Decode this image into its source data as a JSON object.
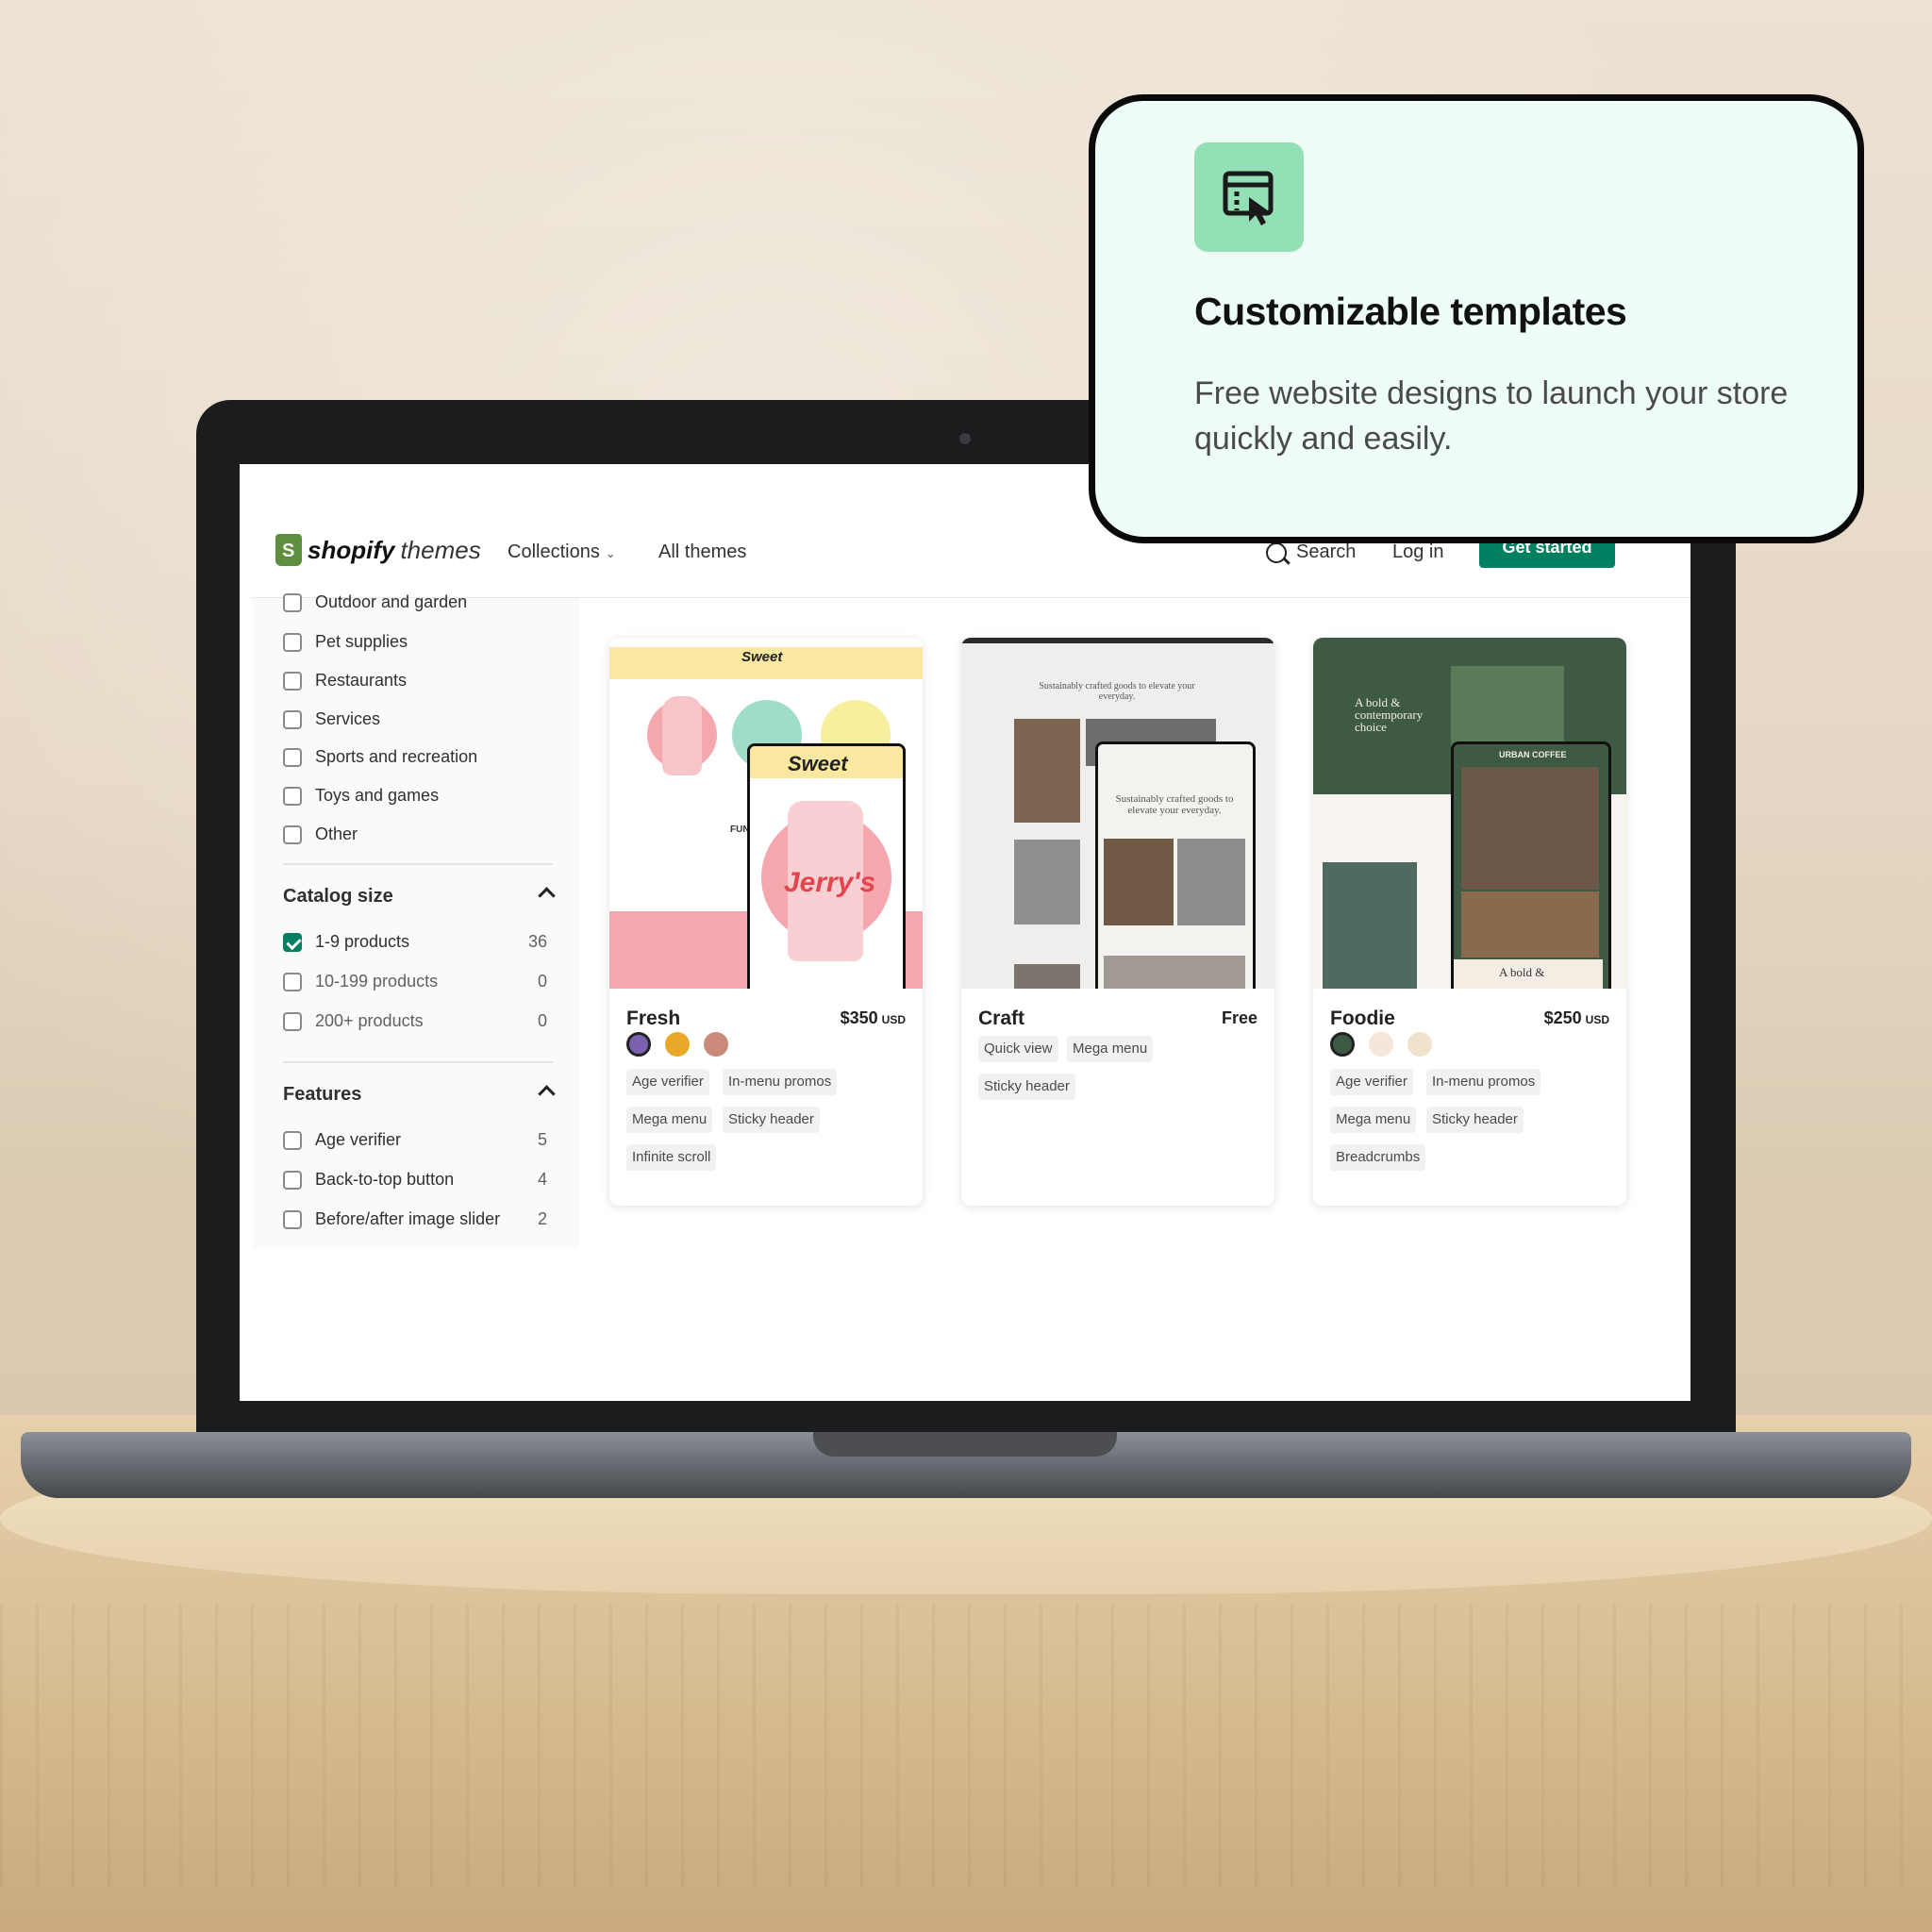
{
  "overlay": {
    "title": "Customizable templates",
    "subtitle": "Free website designs to launch your store quickly and easily.",
    "icon": "template-cursor-icon",
    "accent": "#93e0b6"
  },
  "nav": {
    "brand": "shopify",
    "brand_suffix": "themes",
    "collections": "Collections",
    "all_themes": "All themes",
    "search": "Search",
    "login": "Log in",
    "get_started": "Get started",
    "accent": "#008060"
  },
  "sidebar": {
    "industry_items": [
      {
        "label": "Outdoor and garden",
        "checked": false
      },
      {
        "label": "Pet supplies",
        "checked": false
      },
      {
        "label": "Restaurants",
        "checked": false
      },
      {
        "label": "Services",
        "checked": false
      },
      {
        "label": "Sports and recreation",
        "checked": false
      },
      {
        "label": "Toys and games",
        "checked": false
      },
      {
        "label": "Other",
        "checked": false
      }
    ],
    "catalog_size": {
      "title": "Catalog size",
      "items": [
        {
          "label": "1-9 products",
          "count": "36",
          "checked": true
        },
        {
          "label": "10-199 products",
          "count": "0",
          "checked": false
        },
        {
          "label": "200+ products",
          "count": "0",
          "checked": false
        }
      ]
    },
    "features": {
      "title": "Features",
      "items": [
        {
          "label": "Age verifier",
          "count": "5",
          "checked": false
        },
        {
          "label": "Back-to-top button",
          "count": "4",
          "checked": false
        },
        {
          "label": "Before/after image slider",
          "count": "2",
          "checked": false
        }
      ]
    }
  },
  "themes": [
    {
      "name": "Fresh",
      "price": "$350",
      "currency": "USD",
      "swatches": [
        "#7b62b0",
        "#eaa82a",
        "#c98a7a"
      ],
      "tags": [
        "Age verifier",
        "In-menu promos",
        "Mega menu",
        "Sticky header",
        "Infinite scroll"
      ],
      "preview": {
        "desktop_logo": "Sweet",
        "mobile_logo": "Sweet",
        "can_text": "Jerry's",
        "fun_text": "FUN."
      }
    },
    {
      "name": "Craft",
      "price": "Free",
      "currency": "",
      "swatches": [],
      "tags": [
        "Quick view",
        "Mega menu",
        "Sticky header"
      ],
      "preview": {
        "headline": "Sustainably crafted goods to elevate your everyday.",
        "mobile_headline": "Sustainably crafted goods to elevate your everyday."
      }
    },
    {
      "name": "Foodie",
      "price": "$250",
      "currency": "USD",
      "swatches": [
        "#3d5a44",
        "#f5e6dc",
        "#f0e3cc"
      ],
      "tags": [
        "Age verifier",
        "In-menu promos",
        "Mega menu",
        "Sticky header",
        "Breadcrumbs"
      ],
      "preview": {
        "headline": "A bold & contemporary choice",
        "mobile_brand": "URBAN COFFEE",
        "mobile_headline": "A bold &"
      }
    }
  ]
}
